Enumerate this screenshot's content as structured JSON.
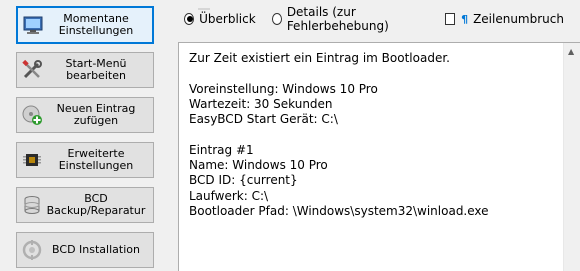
{
  "sidebar": {
    "items": [
      {
        "label": "Momentane\nEinstellungen",
        "icon": "monitor-icon",
        "active": true
      },
      {
        "label": "Start-Menü\nbearbeiten",
        "icon": "tools-icon",
        "active": false
      },
      {
        "label": "Neuen Eintrag\nzufügen",
        "icon": "add-disk-icon",
        "active": false
      },
      {
        "label": "Erweiterte\nEinstellungen",
        "icon": "chip-icon",
        "active": false
      },
      {
        "label": "BCD\nBackup/Reparatur",
        "icon": "backup-icon",
        "active": false
      },
      {
        "label": "BCD Installation",
        "icon": "bcd-install-icon",
        "active": false
      }
    ]
  },
  "options": {
    "overview_label": "Überblick",
    "details_label": "Details (zur Fehlerbehebung)",
    "wrap_label": "Zeilenumbruch",
    "selected": "overview",
    "wrap_checked": false
  },
  "output": {
    "lines": [
      "Zur Zeit existiert ein Eintrag im Bootloader.",
      "",
      "Voreinstellung: Windows 10 Pro",
      "Wartezeit: 30 Sekunden",
      "EasyBCD Start Gerät: C:\\",
      "",
      "Eintrag #1",
      "Name: Windows 10 Pro",
      "BCD ID: {current}",
      "Laufwerk: C:\\",
      "Bootloader Pfad: \\Windows\\system32\\winload.exe"
    ]
  },
  "colors": {
    "accent": "#0078d7",
    "button_bg": "#e1e1e1",
    "window_bg": "#f0f0f0"
  }
}
